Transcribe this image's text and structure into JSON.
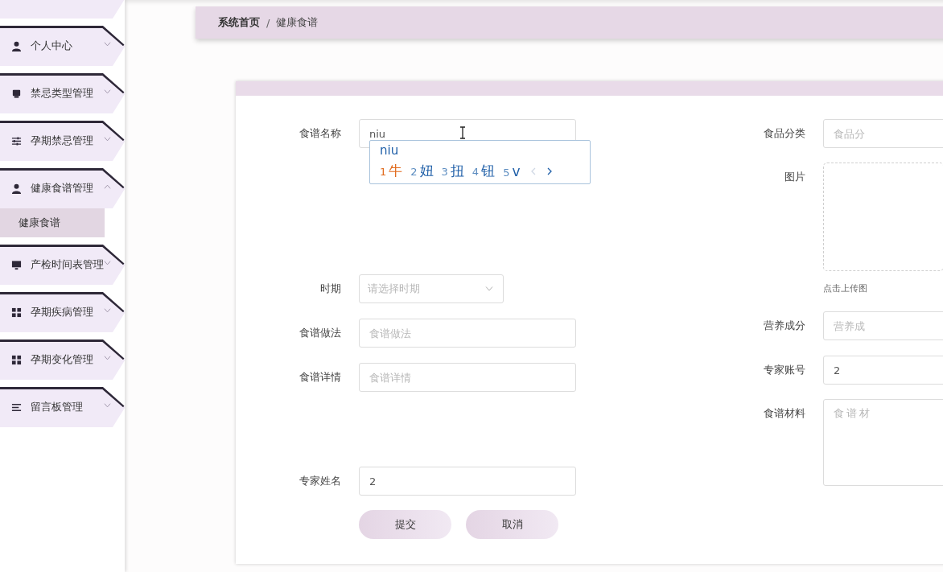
{
  "sidebar": {
    "items": [
      {
        "label": "个人中心",
        "kind": "person",
        "expanded": false
      },
      {
        "label": "禁忌类型管理",
        "kind": "printer",
        "expanded": false
      },
      {
        "label": "孕期禁忌管理",
        "kind": "sliders",
        "expanded": false
      },
      {
        "label": "健康食谱管理",
        "kind": "person",
        "expanded": true,
        "children": [
          {
            "label": "健康食谱",
            "selected": true
          }
        ]
      },
      {
        "label": "产检时间表管理",
        "kind": "monitor",
        "expanded": false
      },
      {
        "label": "孕期疾病管理",
        "kind": "grid",
        "expanded": false
      },
      {
        "label": "孕期变化管理",
        "kind": "grid",
        "expanded": false
      },
      {
        "label": "留言板管理",
        "kind": "lines",
        "expanded": false
      }
    ]
  },
  "breadcrumb": {
    "separator": "/",
    "items": [
      "系统首页",
      "健康食谱"
    ]
  },
  "form": {
    "left": [
      {
        "kind": "text",
        "label": "食谱名称",
        "value": "niu"
      },
      {
        "kind": "select",
        "label": "时期",
        "placeholder": "请选择时期"
      },
      {
        "kind": "text",
        "label": "食谱做法",
        "placeholder": "食谱做法"
      },
      {
        "kind": "text",
        "label": "食谱详情",
        "placeholder": "食谱详情"
      },
      {
        "kind": "text",
        "label": "专家姓名",
        "value": "2"
      }
    ],
    "right": [
      {
        "kind": "text",
        "label": "食品分类",
        "placeholder": "食品分"
      },
      {
        "kind": "upload",
        "label": "图片",
        "hint": "点击上传图"
      },
      {
        "kind": "text",
        "label": "营养成分",
        "placeholder": "营养成"
      },
      {
        "kind": "text",
        "label": "专家账号",
        "value": "2"
      },
      {
        "kind": "textarea",
        "label": "食谱材料",
        "placeholder": "食谱材"
      }
    ],
    "buttons": [
      "提交",
      "取消"
    ]
  },
  "ime": {
    "composition": "niu",
    "candidates": [
      {
        "number": "1",
        "text": "牛",
        "selected": true
      },
      {
        "number": "2",
        "text": "妞",
        "selected": false
      },
      {
        "number": "3",
        "text": "扭",
        "selected": false
      },
      {
        "number": "4",
        "text": "钮",
        "selected": false
      },
      {
        "number": "5",
        "text": "v",
        "selected": false
      }
    ],
    "prev_disabled": true,
    "next_disabled": false
  }
}
